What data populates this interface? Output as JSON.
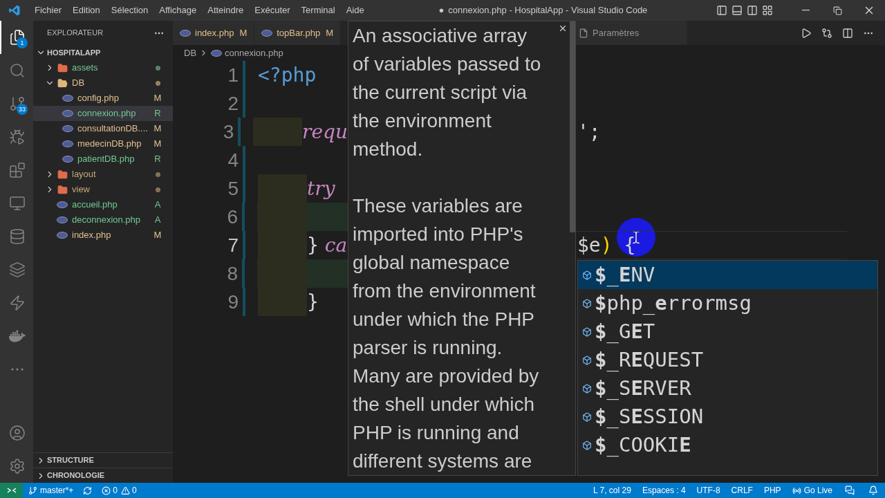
{
  "window": {
    "dirty_mark": "●",
    "title": "connexion.php - HospitalApp - Visual Studio Code"
  },
  "menu": [
    "Fichier",
    "Edition",
    "Sélection",
    "Affichage",
    "Atteindre",
    "Exécuter",
    "Terminal",
    "Aide"
  ],
  "activity_bar": [
    {
      "kind": "explorer",
      "selected": true,
      "badge": "1"
    },
    {
      "kind": "search",
      "selected": false
    },
    {
      "kind": "source-control",
      "selected": false,
      "badge": "33"
    },
    {
      "kind": "debug",
      "selected": false
    },
    {
      "kind": "extensions",
      "selected": false
    },
    {
      "kind": "remote",
      "selected": false
    },
    {
      "kind": "database",
      "selected": false
    },
    {
      "kind": "layers",
      "selected": false
    },
    {
      "kind": "lightning",
      "selected": false
    },
    {
      "kind": "docker",
      "selected": false
    },
    {
      "kind": "more",
      "selected": false
    }
  ],
  "activity_bar_bottom": [
    {
      "kind": "account",
      "selected": false
    },
    {
      "kind": "settings",
      "selected": false
    }
  ],
  "sidebar": {
    "title": "EXPLORATEUR",
    "section": "HOSPITALAPP",
    "section_expanded": true,
    "items": [
      {
        "kind": "folder",
        "label": "assets",
        "expanded": false,
        "changes": true,
        "selected": false,
        "color": "#73c991"
      },
      {
        "kind": "folder",
        "label": "DB",
        "expanded": true,
        "changes": true,
        "selected": false,
        "color": "#e2c08d",
        "children": [
          {
            "kind": "file",
            "label": "config.php",
            "status": "M",
            "selected": false,
            "color": "#e2c08d"
          },
          {
            "kind": "file",
            "label": "connexion.php",
            "status": "R",
            "selected": true,
            "color": "#73c991"
          },
          {
            "kind": "file",
            "label": "consultationDB....",
            "status": "M",
            "selected": false,
            "color": "#e2c08d"
          },
          {
            "kind": "file",
            "label": "medecinDB.php",
            "status": "M",
            "selected": false,
            "color": "#e2c08d"
          },
          {
            "kind": "file",
            "label": "patientDB.php",
            "status": "R",
            "selected": false,
            "color": "#73c991"
          }
        ]
      },
      {
        "kind": "folder",
        "label": "layout",
        "expanded": false,
        "changes": true,
        "selected": false,
        "color": "#c4a87c"
      },
      {
        "kind": "folder",
        "label": "view",
        "expanded": false,
        "changes": true,
        "selected": false,
        "color": "#c4a87c"
      },
      {
        "kind": "file",
        "label": "accueil.php",
        "status": "A",
        "selected": false,
        "color": "#73c991"
      },
      {
        "kind": "file",
        "label": "deconnexion.php",
        "status": "A",
        "selected": false,
        "color": "#73c991"
      },
      {
        "kind": "file",
        "label": "index.php",
        "status": "M",
        "selected": false,
        "color": "#e2c08d"
      }
    ],
    "panels": [
      {
        "label": "STRUCTURE",
        "expanded": false
      },
      {
        "label": "CHRONOLOGIE",
        "expanded": false
      }
    ]
  },
  "editor": {
    "tabs": [
      {
        "label": "index.php",
        "status": "M",
        "selected": false,
        "color": "#e2c08d"
      },
      {
        "label": "topBar.php",
        "status": "M",
        "selected": false,
        "color": "#e2c08d"
      }
    ],
    "breadcrumb": [
      "DB",
      "connexion.php"
    ],
    "right_tabs": [
      {
        "label": "Paramètres",
        "selected": false
      }
    ],
    "lines": [
      {
        "number": "1",
        "kind": "plain",
        "current": false,
        "left": [
          {
            "text": "<?php",
            "kind": "tag"
          }
        ]
      },
      {
        "number": "2",
        "kind": "plain",
        "current": false
      },
      {
        "number": "3",
        "kind": "indented",
        "current": false,
        "left": [
          {
            "text": "requ",
            "kind": "keyword"
          }
        ],
        "right": [
          {
            "text": "';",
            "kind": "punct"
          }
        ]
      },
      {
        "number": "4",
        "kind": "plain",
        "current": false
      },
      {
        "number": "5",
        "kind": "indented",
        "current": false,
        "left": [
          {
            "text": "try",
            "kind": "keyword"
          }
        ]
      },
      {
        "number": "6",
        "kind": "nested",
        "current": false
      },
      {
        "number": "7",
        "kind": "indented",
        "current": true,
        "left": [
          {
            "text": "}",
            "kind": "punct"
          },
          {
            "text": " ca",
            "kind": "keyword"
          }
        ],
        "right": [
          {
            "text": "$e",
            "kind": "punct"
          },
          {
            "text": ")",
            "kind": "paren"
          },
          {
            "text": " {",
            "kind": "punct"
          }
        ]
      },
      {
        "number": "8",
        "kind": "nested",
        "current": false
      },
      {
        "number": "9",
        "kind": "indented",
        "current": false,
        "left": [
          {
            "text": "}",
            "kind": "punct"
          }
        ]
      }
    ]
  },
  "hover": {
    "paragraphs": [
      "An associative array of variables passed to the current script via the environment method.",
      "These variables are imported into PHP's global namespace from the environment under which the PHP parser is running. Many are provided by the shell under which PHP is running and different systems are"
    ]
  },
  "suggest": {
    "items": [
      {
        "label": "**$**_**E**NV",
        "selected": true
      },
      {
        "label": "**$**php_**e**rrormsg",
        "selected": false
      },
      {
        "label": "**$**_G**E**T",
        "selected": false
      },
      {
        "label": "**$**_R**E**QUEST",
        "selected": false
      },
      {
        "label": "**$**_S**E**RVER",
        "selected": false
      },
      {
        "label": "**$**_S**E**SSION",
        "selected": false
      },
      {
        "label": "**$**_COOKI**E**",
        "selected": false
      }
    ]
  },
  "status_bar": {
    "branch": "master*+",
    "errors": "0",
    "warnings": "0",
    "right": [
      "L 7, col 29",
      "Espaces : 4",
      "UTF-8",
      "CRLF",
      "PHP"
    ],
    "go_live": "Go Live"
  }
}
